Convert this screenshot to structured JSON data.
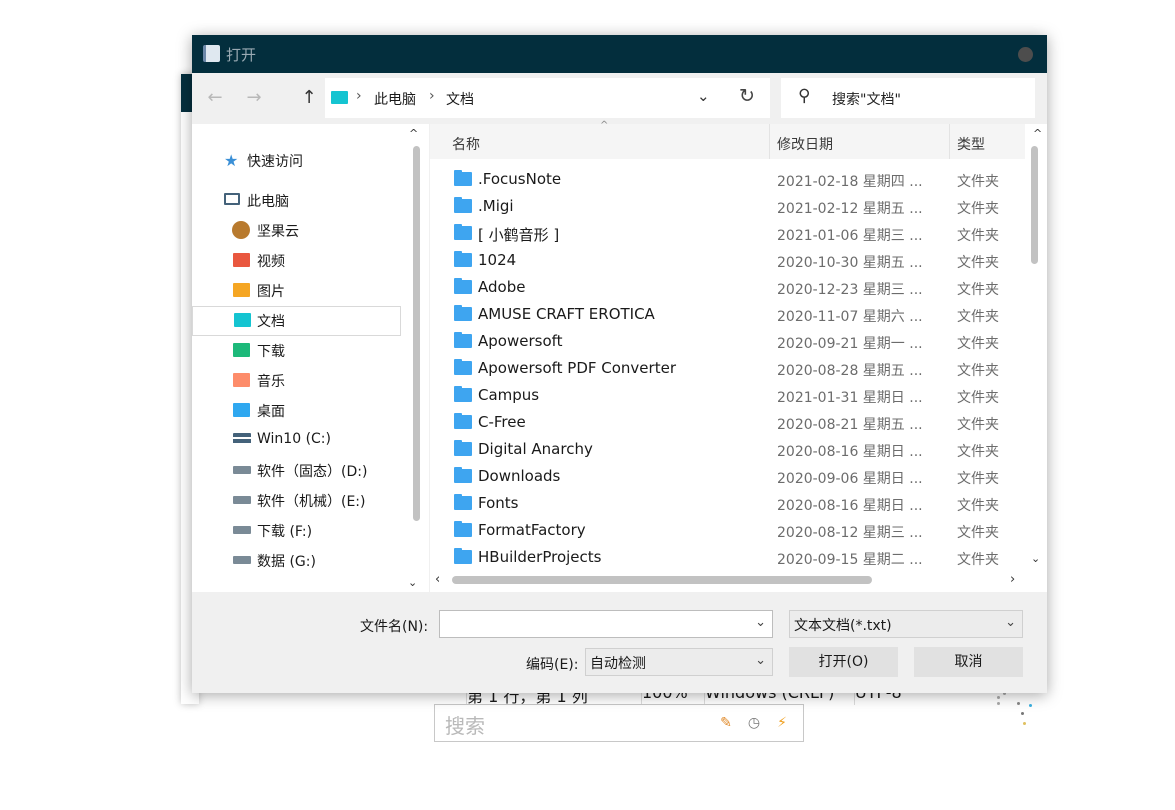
{
  "dialog": {
    "title": "打开"
  },
  "address": {
    "crumbs": [
      "此电脑",
      "文档"
    ],
    "separator": "›"
  },
  "search": {
    "placeholder": "搜索\"文档\""
  },
  "navpane": {
    "quick_access": "快速访问",
    "this_pc": "此电脑",
    "items": [
      "坚果云",
      "视频",
      "图片",
      "文档",
      "下载",
      "音乐",
      "桌面"
    ],
    "drives": [
      "Win10 (C:)",
      "软件（固态）(D:)",
      "软件（机械）(E:)",
      "下载 (F:)",
      "数据 (G:)"
    ]
  },
  "columns": {
    "name": "名称",
    "date": "修改日期",
    "type": "类型"
  },
  "files": [
    {
      "name": ".FocusNote",
      "date": "2021-02-18 星期四 ...",
      "type": "文件夹"
    },
    {
      "name": ".Migi",
      "date": "2021-02-12 星期五 ...",
      "type": "文件夹"
    },
    {
      "name": "[ 小鹤音形 ]",
      "date": "2021-01-06 星期三 ...",
      "type": "文件夹"
    },
    {
      "name": "1024",
      "date": "2020-10-30 星期五 ...",
      "type": "文件夹"
    },
    {
      "name": "Adobe",
      "date": "2020-12-23 星期三 ...",
      "type": "文件夹"
    },
    {
      "name": "AMUSE CRAFT EROTICA",
      "date": "2020-11-07 星期六 ...",
      "type": "文件夹"
    },
    {
      "name": "Apowersoft",
      "date": "2020-09-21 星期一 ...",
      "type": "文件夹"
    },
    {
      "name": "Apowersoft PDF Converter",
      "date": "2020-08-28 星期五 ...",
      "type": "文件夹"
    },
    {
      "name": "Campus",
      "date": "2021-01-31 星期日 ...",
      "type": "文件夹"
    },
    {
      "name": "C-Free",
      "date": "2020-08-21 星期五 ...",
      "type": "文件夹"
    },
    {
      "name": "Digital Anarchy",
      "date": "2020-08-16 星期日 ...",
      "type": "文件夹"
    },
    {
      "name": "Downloads",
      "date": "2020-09-06 星期日 ...",
      "type": "文件夹"
    },
    {
      "name": "Fonts",
      "date": "2020-08-16 星期日 ...",
      "type": "文件夹"
    },
    {
      "name": "FormatFactory",
      "date": "2020-08-12 星期三 ...",
      "type": "文件夹"
    },
    {
      "name": "HBuilderProjects",
      "date": "2020-09-15 星期二 ...",
      "type": "文件夹"
    }
  ],
  "bottom": {
    "filename_label": "文件名(N):",
    "filename_value": "",
    "filetype_value": "文本文档(*.txt)",
    "encoding_label": "编码(E):",
    "encoding_value": "自动检测",
    "open_button": "打开(O)",
    "cancel_button": "取消"
  },
  "status_bar": {
    "position": "第 1 行，第 1 列",
    "zoom": "100%",
    "line_ending": "Windows (CRLF)",
    "encoding": "UTF-8"
  },
  "search_widget": {
    "placeholder": "搜索"
  }
}
